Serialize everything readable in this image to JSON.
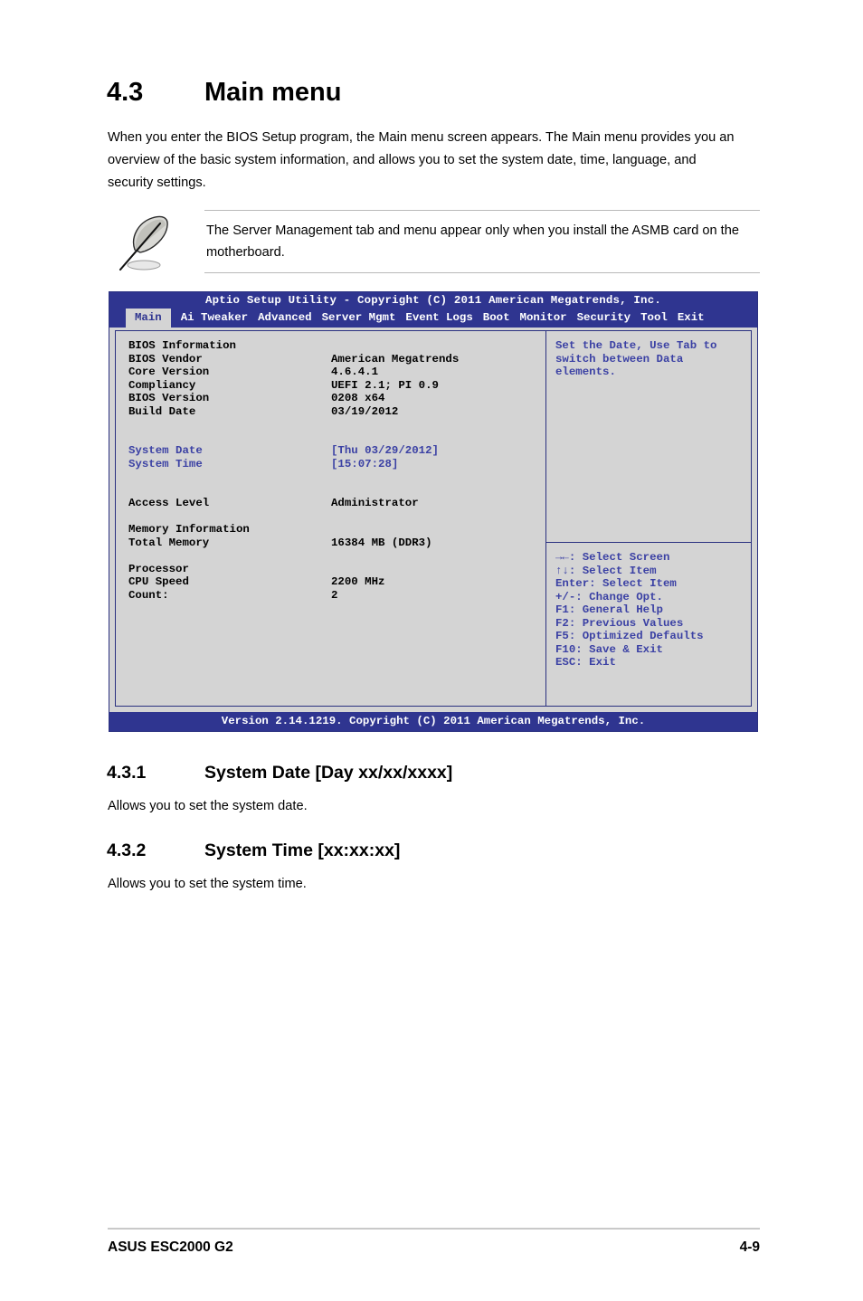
{
  "document": {
    "section": {
      "number": "4.3",
      "title": "Main menu",
      "paragraph": "When you enter the BIOS Setup program, the Main menu screen appears. The Main menu provides you an overview of the basic system information, and allows you to set the system date, time, language, and security settings."
    },
    "note": {
      "icon": "quill-pen-icon",
      "text": "The Server Management tab and menu appear only when you install the ASMB card on the motherboard."
    },
    "subsections": [
      {
        "number": "4.3.1",
        "title": "System Date [Day xx/xx/xxxx]",
        "paragraph": "Allows you to set the system date."
      },
      {
        "number": "4.3.2",
        "title": "System Time [xx:xx:xx]",
        "paragraph": "Allows you to set the system time."
      }
    ],
    "footer": {
      "product": "ASUS ESC2000 G2",
      "page": "4-9"
    }
  },
  "bios": {
    "titlebar": "Aptio Setup Utility - Copyright (C) 2011 American Megatrends, Inc.",
    "tabs": [
      {
        "label": "Main",
        "active": true
      },
      {
        "label": "Ai Tweaker",
        "active": false
      },
      {
        "label": "Advanced",
        "active": false
      },
      {
        "label": "Server Mgmt",
        "active": false
      },
      {
        "label": "Event Logs",
        "active": false
      },
      {
        "label": "Boot",
        "active": false
      },
      {
        "label": "Monitor",
        "active": false
      },
      {
        "label": "Security",
        "active": false
      },
      {
        "label": "Tool",
        "active": false
      },
      {
        "label": "Exit",
        "active": false
      }
    ],
    "left_panel": {
      "group_bios": {
        "heading": "BIOS Information",
        "rows": [
          {
            "label": "BIOS Vendor",
            "value": "American Megatrends"
          },
          {
            "label": "Core Version",
            "value": "4.6.4.1"
          },
          {
            "label": "Compliancy",
            "value": "UEFI 2.1; PI 0.9"
          },
          {
            "label": "BIOS Version",
            "value": "0208 x64"
          },
          {
            "label": "Build Date",
            "value": "03/19/2012"
          }
        ]
      },
      "datetime_rows": [
        {
          "label": "System Date",
          "value": "[Thu 03/29/2012]"
        },
        {
          "label": "System Time",
          "value": "[15:07:28]"
        }
      ],
      "access": {
        "label": "Access Level",
        "value": "Administrator"
      },
      "group_memory": {
        "heading": "Memory Information",
        "rows": [
          {
            "label": "Total Memory",
            "value": "16384 MB (DDR3)"
          }
        ]
      },
      "group_processor": {
        "heading": "Processor",
        "rows": [
          {
            "label": "CPU Speed",
            "value": "2200 MHz"
          },
          {
            "label": "Count:",
            "value": "2"
          }
        ]
      }
    },
    "help": {
      "line1": "Set the Date, Use Tab to",
      "line2": "switch between Data elements."
    },
    "keys": [
      "→←: Select Screen",
      "↑↓:  Select Item",
      "Enter: Select Item",
      "+/-: Change Opt.",
      "F1: General Help",
      "F2: Previous Values",
      "F5: Optimized Defaults",
      "F10: Save & Exit",
      "ESC: Exit"
    ],
    "footer": "Version 2.14.1219. Copyright (C) 2011 American Megatrends, Inc.",
    "colors": {
      "chrome_blue": "#2f3590",
      "panel_gray": "#d4d4d4",
      "highlight_blue": "#3b41a4",
      "border_blue": "#2b3180"
    }
  }
}
